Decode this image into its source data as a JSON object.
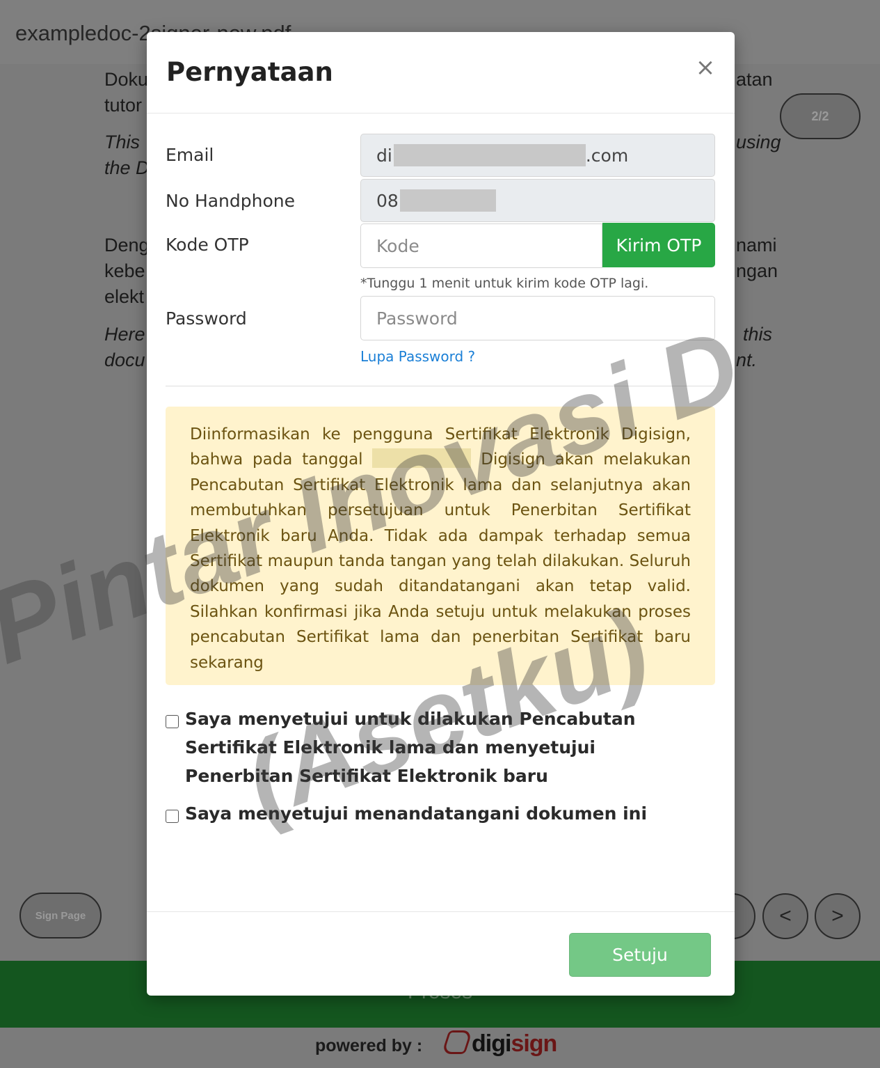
{
  "background": {
    "filename": "exampledoc-2signer-new.pdf",
    "page_counter": "2/2",
    "left_fragments": [
      "Doku",
      "tutor",
      "This",
      "the D",
      "Deng",
      "kebe",
      "elekt",
      "Here",
      "docu"
    ],
    "right_fragments": [
      "atan",
      "using",
      "nami",
      "ngan",
      "this",
      "nt."
    ],
    "sign_page_label": "Sign Page",
    "prev_icon": "<",
    "next_icon": ">",
    "proses_label": "Proses",
    "powered_by": "powered by :",
    "brand_prefix": "digi",
    "brand_suffix": "sign"
  },
  "modal": {
    "title": "Pernyataan",
    "close_icon": "×",
    "email": {
      "label": "Email",
      "value_prefix": "di",
      "value_suffix": ".com"
    },
    "phone": {
      "label": "No Handphone",
      "value_prefix": "08"
    },
    "otp": {
      "label": "Kode OTP",
      "placeholder": "Kode",
      "button": "Kirim OTP",
      "hint": "*Tunggu 1 menit untuk kirim kode OTP lagi."
    },
    "password": {
      "label": "Password",
      "placeholder": "Password",
      "forgot_link": "Lupa Password ?"
    },
    "alert": {
      "text_before_date": "Diinformasikan ke pengguna Sertifikat Elektronik Digisign, bahwa pada tanggal",
      "text_after_date": "Digisign akan melakukan Pencabutan Sertifikat Elektronik lama dan selanjutnya akan membutuhkan persetujuan untuk Penerbitan Sertifikat Elektronik baru Anda. Tidak ada dampak terhadap semua Sertifikat maupun tanda tangan yang telah dilakukan. Seluruh dokumen yang sudah ditandatangani akan tetap valid. Silahkan konfirmasi jika Anda setuju untuk melakukan proses pencabutan Sertifikat lama dan penerbitan Sertifikat baru sekarang"
    },
    "checkbox_revoke": "Saya menyetujui untuk dilakukan Pencabutan Sertifikat Elektronik lama dan menyetujui Penerbitan Sertifikat Elektronik baru",
    "checkbox_sign": "Saya menyetujui menandatangani dokumen ini",
    "submit_button": "Setuju"
  },
  "watermark": {
    "line1": "Pintar Inovasi D",
    "line2": "(Asetku)"
  },
  "colors": {
    "primary_green": "#28a745",
    "disabled_green": "#74c886",
    "alert_bg": "#fff3cd",
    "proses_bar": "#14561f",
    "link_blue": "#1a7fd6"
  }
}
